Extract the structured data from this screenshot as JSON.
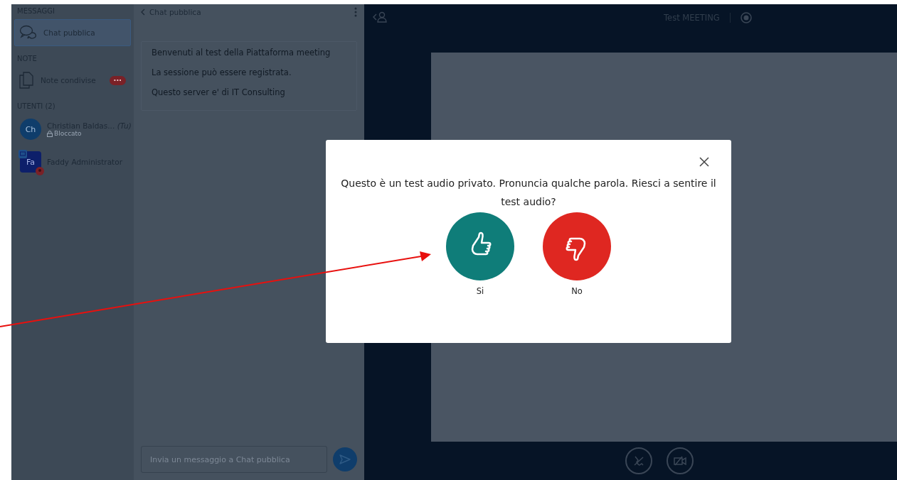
{
  "sidebar": {
    "sections": [
      {
        "title": "MESSAGGI",
        "items": [
          {
            "kind": "chat",
            "label": "Chat pubblica",
            "selected": true
          }
        ]
      },
      {
        "title": "NOTE",
        "items": [
          {
            "kind": "notes",
            "label": "Note condivise",
            "badge": "···",
            "selected": false
          }
        ]
      }
    ],
    "users_title": "UTENTI (2)",
    "users": [
      {
        "kind": "round",
        "initials": "Ch",
        "name": "Christian Baldas...",
        "tag": "(Tu)",
        "status": "Bloccato"
      },
      {
        "kind": "square",
        "initials": "Fa",
        "name": "Faddy Administrator"
      }
    ]
  },
  "chat": {
    "title": "Chat pubblica",
    "messages": [
      "Benvenuti al test della Piattaforma meeting",
      "La sessione può essere registrata.",
      "Questo server e' di IT Consulting"
    ],
    "input": {
      "placeholder": "Invia un messaggio a Chat pubblica"
    }
  },
  "main": {
    "meeting_title": "Test MEETING"
  },
  "modal": {
    "text": "Questo è un test audio privato. Pronuncia qualche parola. Riesci a sentire il test audio?",
    "buttons": [
      {
        "kind": "yes",
        "label": "Si"
      },
      {
        "kind": "no",
        "label": "No"
      }
    ]
  }
}
